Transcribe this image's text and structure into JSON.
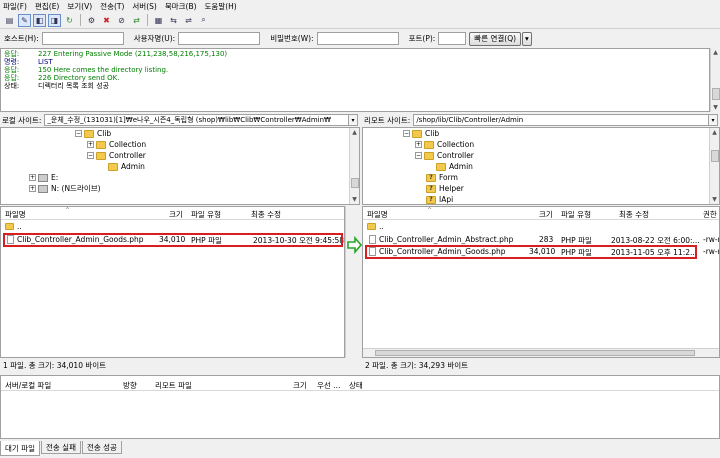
{
  "menu": [
    "파일(F)",
    "편집(E)",
    "보기(V)",
    "전송(T)",
    "서버(S)",
    "북마크(B)",
    "도움말(H)"
  ],
  "toolbar": [
    "site-manager-icon",
    "toggle-log-icon",
    "toggle-local-tree-icon",
    "toggle-remote-tree-icon",
    "refresh-icon",
    "process-queue-icon",
    "cancel-icon",
    "disconnect-icon",
    "reconnect-icon",
    "filter-icon",
    "compare-icon",
    "sync-browse-icon",
    "search-icon"
  ],
  "quickconnect": {
    "host_label": "호스트(H):",
    "user_label": "사용자명(U):",
    "pass_label": "비밀번호(W):",
    "port_label": "포트(P):",
    "button": "빠른 연결(Q)",
    "host": "",
    "user": "",
    "pass": "",
    "port": ""
  },
  "log": [
    {
      "label": "응답:",
      "text": "227 Entering Passive Mode (211,238,58,216,175,130)",
      "color": "#008000"
    },
    {
      "label": "명령:",
      "text": "LIST",
      "color": "#000080"
    },
    {
      "label": "응답:",
      "text": "150 Here comes the directory listing.",
      "color": "#008000"
    },
    {
      "label": "응답:",
      "text": "226 Directory send OK.",
      "color": "#008000"
    },
    {
      "label": "상태:",
      "text": "디렉터리 목록 조회 성공",
      "color": "#000000"
    }
  ],
  "local": {
    "site_label": "로컬 사이트:",
    "path": "_운체_수정_(131031)[1]₩e나우_시즌4_독립형 (shop)₩lib₩Clib₩Controller₩Admin₩",
    "tree": [
      {
        "label": "Clib",
        "type": "folder"
      },
      {
        "label": "Collection",
        "type": "folder"
      },
      {
        "label": "Controller",
        "type": "folder"
      },
      {
        "label": "Admin",
        "type": "folder"
      },
      {
        "label": "E:",
        "type": "drive"
      },
      {
        "label": "N: (N드라이브)",
        "type": "drive"
      }
    ],
    "columns": [
      "파일명",
      "크기",
      "파일 유형",
      "최종 수정"
    ],
    "files": [
      {
        "name": "..",
        "size": "",
        "type": "",
        "modified": ""
      },
      {
        "name": "Clib_Controller_Admin_Goods.php",
        "size": "34,010",
        "type": "PHP 파일",
        "modified": "2013-10-30 오전 9:45:58"
      }
    ],
    "status": "1 파일. 총 크기: 34,010 바이트"
  },
  "remote": {
    "site_label": "리모트 사이트:",
    "path": "/shop/lib/Clib/Controller/Admin",
    "tree": [
      {
        "label": "Clib",
        "type": "folder"
      },
      {
        "label": "Collection",
        "type": "folder"
      },
      {
        "label": "Controller",
        "type": "folder"
      },
      {
        "label": "Admin",
        "type": "folder"
      },
      {
        "label": "Form",
        "type": "unknown"
      },
      {
        "label": "Helper",
        "type": "unknown"
      },
      {
        "label": "IApi",
        "type": "unknown"
      }
    ],
    "columns": [
      "파일명",
      "크기",
      "파일 유형",
      "최종 수정",
      "권한"
    ],
    "files": [
      {
        "name": "..",
        "size": "",
        "type": "",
        "modified": "",
        "perm": ""
      },
      {
        "name": "Clib_Controller_Admin_Abstract.php",
        "size": "283",
        "type": "PHP 파일",
        "modified": "2013-08-22 오전 6:00:...",
        "perm": "-rw-r"
      },
      {
        "name": "Clib_Controller_Admin_Goods.php",
        "size": "34,010",
        "type": "PHP 파일",
        "modified": "2013-11-05 오후 11:2...",
        "perm": "-rw-r"
      }
    ],
    "status": "2 파일. 총 크기: 34,293 바이트"
  },
  "queue": {
    "columns": [
      "서버/로컬 파일",
      "방향",
      "리모트 파일",
      "크기",
      "우선 ...",
      "상태"
    ]
  },
  "tabs": [
    "대기 파일",
    "전송 실패",
    "전송 성공"
  ],
  "colors": {
    "highlight": "#d81e1e",
    "arrow": "#2aa52a",
    "folder": "#f2c94c"
  }
}
